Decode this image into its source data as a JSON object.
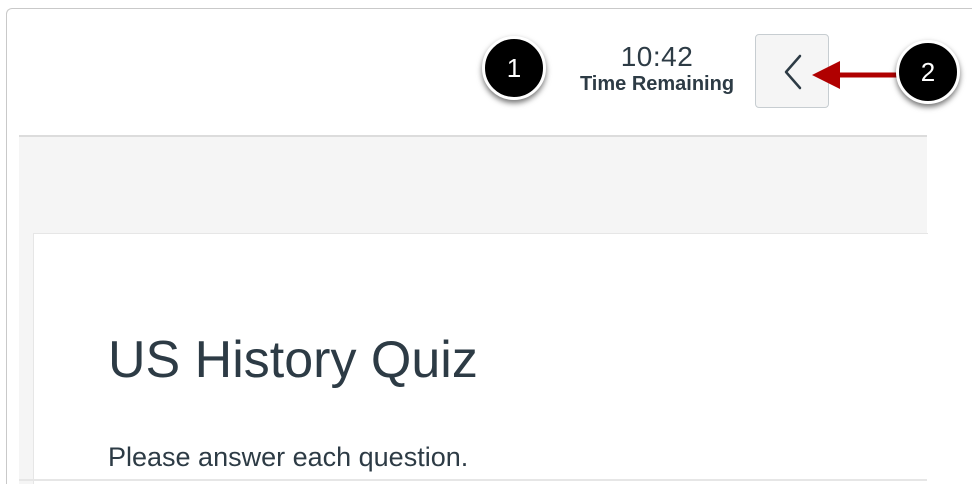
{
  "header": {
    "timer": {
      "value": "10:42",
      "label": "Time Remaining"
    },
    "collapse_button": {
      "icon": "chevron-left-icon",
      "aria_label": "Collapse"
    }
  },
  "callouts": {
    "one": "1",
    "two": "2"
  },
  "quiz": {
    "title": "US History Quiz",
    "instructions": "Please answer each question."
  },
  "colors": {
    "text": "#2d3b45",
    "arrow": "#b00000",
    "band": "#f5f5f5",
    "button_bg": "#f5f5f5"
  }
}
